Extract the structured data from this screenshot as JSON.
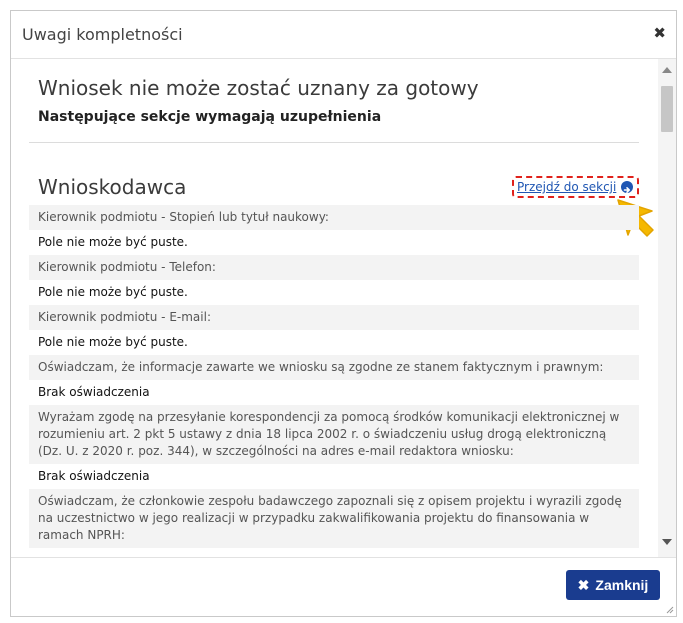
{
  "dialog": {
    "title": "Uwagi kompletności",
    "close_icon": "close-icon",
    "heading": "Wniosek nie może zostać uznany za gotowy",
    "subheading": "Następujące sekcje wymagają uzupełnienia",
    "section": {
      "title": "Wnioskodawca",
      "goto_link": "Przejdź do sekcji",
      "goto_icon": "arrow-circle-right-icon",
      "highlight_color": "#e0211b",
      "pointer_icon": "cursor-pointer-icon",
      "pointer_color": "#f5b800"
    },
    "rows": [
      {
        "type": "q",
        "text": "Kierownik podmiotu - Stopień lub tytuł naukowy:"
      },
      {
        "type": "a",
        "text": "Pole nie może być puste."
      },
      {
        "type": "q",
        "text": "Kierownik podmiotu - Telefon:"
      },
      {
        "type": "a",
        "text": "Pole nie może być puste."
      },
      {
        "type": "q",
        "text": "Kierownik podmiotu - E-mail:"
      },
      {
        "type": "a",
        "text": "Pole nie może być puste."
      },
      {
        "type": "q",
        "text": "Oświadczam, że informacje zawarte we wniosku są zgodne ze stanem faktycznym i prawnym:"
      },
      {
        "type": "a",
        "text": "Brak oświadczenia"
      },
      {
        "type": "q",
        "text": "Wyrażam zgodę na przesyłanie korespondencji za pomocą środków komunikacji elektronicznej w rozumieniu art. 2 pkt 5 ustawy z dnia 18 lipca 2002 r. o świadczeniu usług drogą elektroniczną (Dz. U. z 2020 r. poz. 344), w szczególności na adres e-mail redaktora wniosku:"
      },
      {
        "type": "a",
        "text": "Brak oświadczenia"
      },
      {
        "type": "q",
        "text": "Oświadczam, że członkowie zespołu badawczego zapoznali się z opisem projektu i wyrazili zgodę na uczestnictwo w jego realizacji w przypadku zakwalifikowania projektu do finansowania w ramach NPRH:"
      }
    ],
    "footer": {
      "close_button_label": "Zamknij",
      "close_button_icon": "close-icon",
      "button_color": "#1a3c8f"
    }
  }
}
